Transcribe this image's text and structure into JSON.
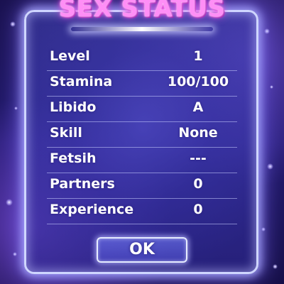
{
  "title": "SEX STATUS",
  "stats": [
    {
      "label": "Level",
      "value": "1"
    },
    {
      "label": "Stamina",
      "value": "100/100"
    },
    {
      "label": "Libido",
      "value": "A"
    },
    {
      "label": "Skill",
      "value": "None"
    },
    {
      "label": "Fetsih",
      "value": "---"
    },
    {
      "label": "Partners",
      "value": "0"
    },
    {
      "label": "Experience",
      "value": "0"
    }
  ],
  "ok_label": "OK",
  "colors": {
    "title": "#ff8ef6",
    "panel_border": "#cfd6ff",
    "text": "#ffffff",
    "background": "#221a6e"
  }
}
